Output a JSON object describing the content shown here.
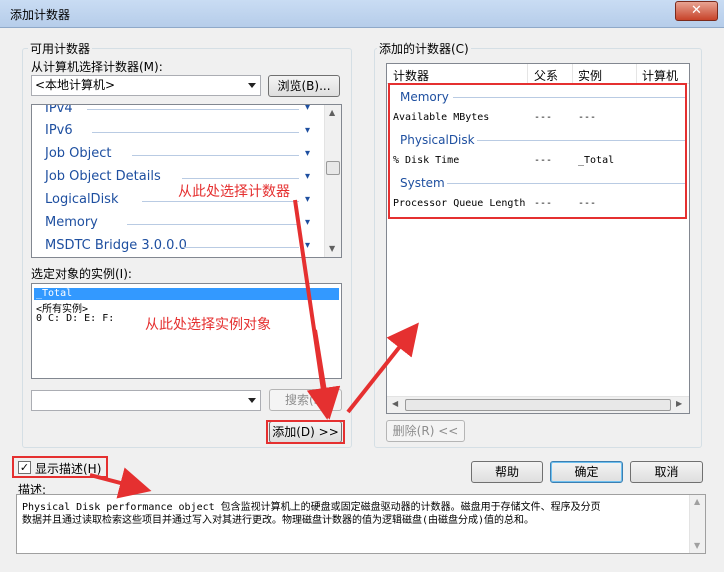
{
  "window": {
    "title": "添加计数器",
    "close_glyph": "✕"
  },
  "available": {
    "group_label": "可用计数器",
    "select_from_label": "从计算机选择计数器(M):",
    "computer_value": "<本地计算机>",
    "browse_label": "浏览(B)...",
    "objects": [
      "IPv4",
      "IPv6",
      "Job Object",
      "Job Object Details",
      "LogicalDisk",
      "Memory",
      "MSDTC Bridge 3.0.0.0"
    ],
    "instances_label": "选定对象的实例(I):",
    "instances": [
      "_Total",
      "<所有实例>",
      "0 C: D: E: F:"
    ],
    "search_value": "",
    "search_label": "搜索(S)",
    "add_label": "添加(D) >>"
  },
  "added": {
    "group_label": "添加的计数器(C)",
    "columns": [
      "计数器",
      "父系",
      "实例",
      "计算机"
    ],
    "groups": [
      {
        "name": "Memory",
        "counters": [
          {
            "name": "Available MBytes",
            "parent": "---",
            "instance": "---"
          }
        ]
      },
      {
        "name": "PhysicalDisk",
        "counters": [
          {
            "name": "% Disk Time",
            "parent": "---",
            "instance": "_Total"
          }
        ]
      },
      {
        "name": "System",
        "counters": [
          {
            "name": "Processor Queue Length",
            "parent": "---",
            "instance": "---"
          }
        ]
      }
    ],
    "remove_label": "删除(R) <<"
  },
  "options": {
    "show_description_label": "显示描述(H)",
    "show_description_checked": true
  },
  "buttons": {
    "help": "帮助",
    "ok": "确定",
    "cancel": "取消"
  },
  "description": {
    "label": "描述:",
    "text_line1": "Physical Disk performance object 包含监视计算机上的硬盘或固定磁盘驱动器的计数器。磁盘用于存储文件、程序及分页",
    "text_line2": "数据并且通过读取检索这些项目并通过写入对其进行更改。物理磁盘计数器的值为逻辑磁盘(由磁盘分成)值的总和。"
  },
  "annotations": {
    "counter_hint": "从此处选择计数器",
    "instance_hint": "从此处选择实例对象"
  },
  "colors": {
    "annotation": "#e53030",
    "selection": "#3399ff",
    "object_text": "#1e4fa0"
  }
}
